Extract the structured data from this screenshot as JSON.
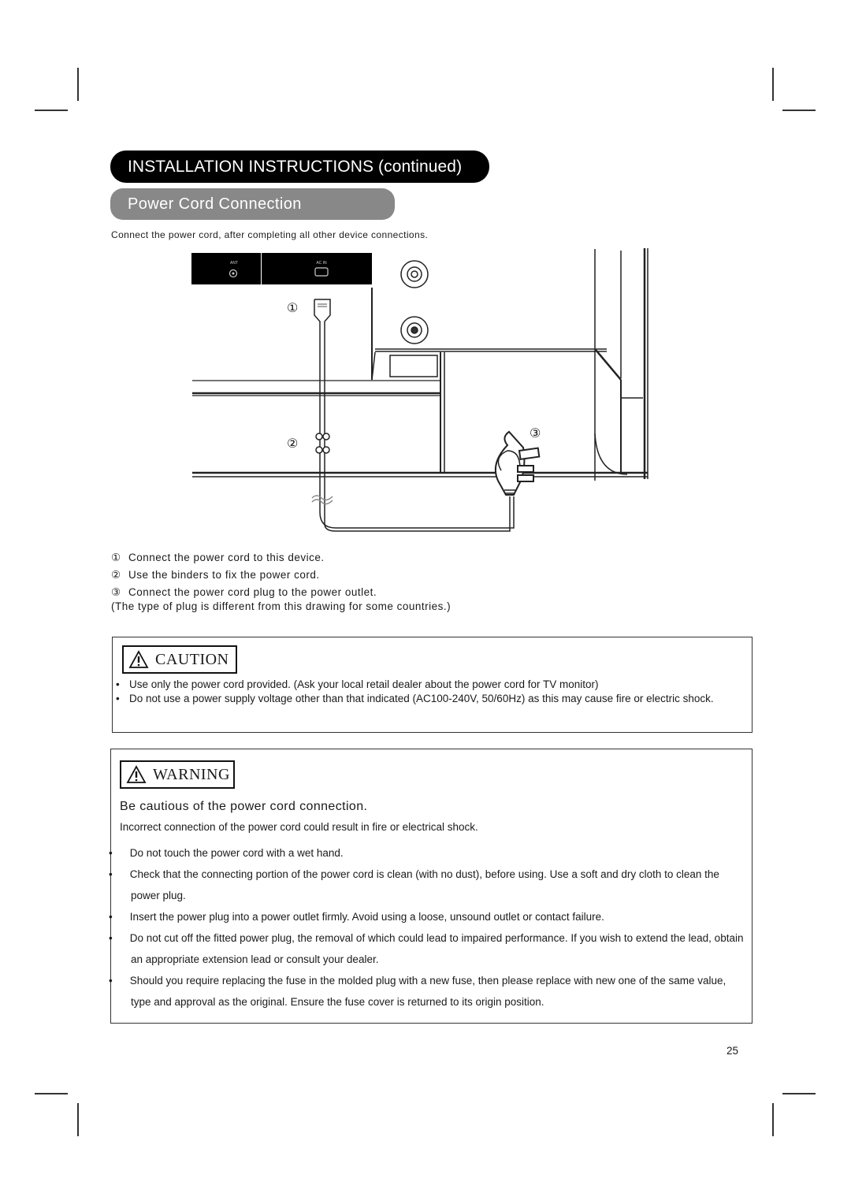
{
  "header": {
    "section_title": "INSTALLATION INSTRUCTIONS (continued)",
    "subsection_title": "Power Cord Connection",
    "intro": "Connect the power cord, after completing all other device connections."
  },
  "diagram": {
    "panel_labels": {
      "antenna": "ANT",
      "ac_in": "AC IN"
    },
    "callouts": [
      "①",
      "②",
      "③"
    ]
  },
  "steps": [
    {
      "num": "①",
      "text": "Connect the power cord to this device."
    },
    {
      "num": "②",
      "text": "Use the binders to fix the power cord."
    },
    {
      "num": "③",
      "text": "Connect the power cord plug to the power outlet."
    }
  ],
  "steps_note": "(The type of plug is different from this drawing for some countries.)",
  "caution": {
    "label": "CAUTION",
    "icon": "warning-triangle-icon",
    "items": [
      "Use only the power cord provided. (Ask your local retail dealer about the power cord for TV monitor)",
      "Do not use a power supply voltage other than that indicated (AC100-240V, 50/60Hz) as this may cause fire or electric shock."
    ]
  },
  "warning": {
    "label": "WARNING",
    "icon": "warning-triangle-icon",
    "heading": "Be cautious of the power cord connection.",
    "lead": "Incorrect connection of the power cord could result in fire or electrical shock.",
    "items": [
      "Do not touch the power cord with a wet hand.",
      "Check that the connecting portion of the power cord is clean (with no dust), before using. Use a soft and dry cloth to clean the power plug.",
      "Insert the power plug into a power outlet firmly. Avoid using a loose, unsound outlet or contact failure.",
      "Do not cut off the fitted power plug, the removal of which could lead to impaired performance. If you wish to extend the lead, obtain an appropriate extension lead or consult your dealer.",
      "Should you require replacing the fuse in the molded plug with a new fuse, then please replace with new one of the same value, type and approval as the original. Ensure the fuse cover is returned to its origin position."
    ]
  },
  "footer": {
    "page_number": "25"
  }
}
